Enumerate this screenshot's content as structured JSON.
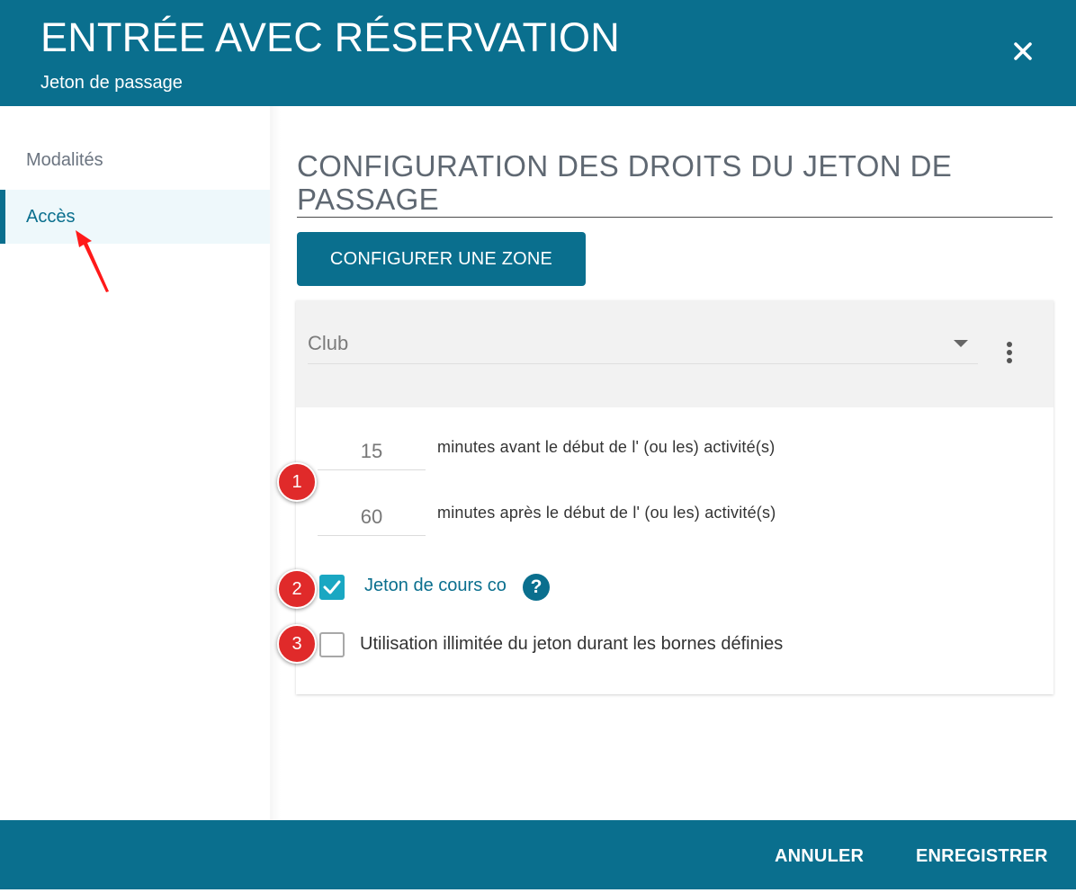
{
  "header": {
    "title": "ENTRÉE AVEC RÉSERVATION",
    "subtitle": "Jeton de passage",
    "close_icon": "close-icon"
  },
  "sidebar": {
    "items": [
      {
        "label": "Modalités",
        "active": false
      },
      {
        "label": "Accès",
        "active": true
      }
    ]
  },
  "main": {
    "section_title": "CONFIGURATION DES DROITS DU JETON DE PASSAGE",
    "configure_zone_label": "CONFIGURER UNE ZONE",
    "zone_card": {
      "selected_zone": "Club",
      "minutes_before": "15",
      "minutes_before_label": "minutes avant le début de l' (ou les) activité(s)",
      "minutes_after": "60",
      "minutes_after_label": "minutes après le début de l' (ou les) activité(s)",
      "course_token_label": "Jeton de cours co",
      "course_token_checked": true,
      "help_glyph": "?",
      "unlimited_label": "Utilisation illimitée du jeton durant les bornes définies",
      "unlimited_checked": false
    }
  },
  "annotations": {
    "badges": [
      "1",
      "2",
      "3"
    ],
    "badge_color": "#e02a2a"
  },
  "footer": {
    "cancel_label": "ANNULER",
    "save_label": "ENREGISTRER"
  },
  "colors": {
    "primary": "#0a6f8e",
    "checkbox": "#1aa7c2",
    "sidebar_active_bg": "#eef8fb"
  }
}
